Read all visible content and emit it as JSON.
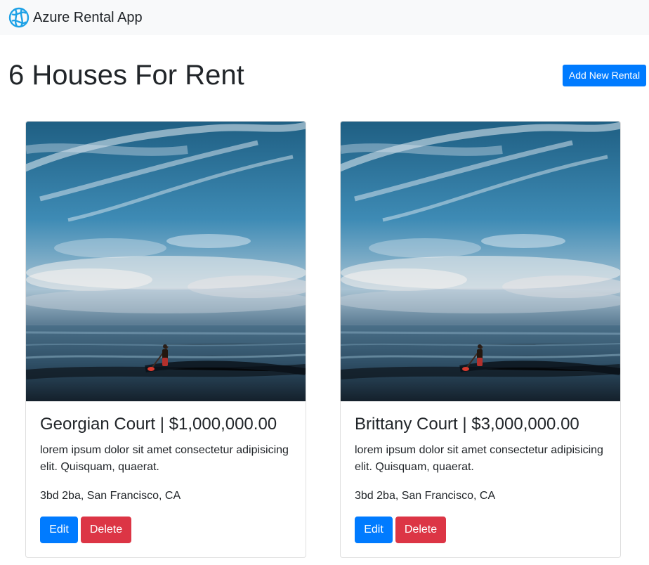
{
  "navbar": {
    "brand_label": "Azure Rental App",
    "brand_icon": "azure-globe-icon",
    "accent_color": "#1da1e6"
  },
  "header": {
    "title": "6 Houses For Rent",
    "add_button_label": "Add New Rental"
  },
  "colors": {
    "primary": "#007bff",
    "danger": "#dc3545",
    "navbar_bg": "#f8f9fa"
  },
  "rentals": [
    {
      "title": "Georgian Court | $1,000,000.00",
      "description": "lorem ipsum dolor sit amet consectetur adipisicing elit. Quisquam, quaerat.",
      "location": "3bd 2ba, San Francisco, CA",
      "image": "ocean-paddleboarder-photo",
      "edit_label": "Edit",
      "delete_label": "Delete"
    },
    {
      "title": "Brittany Court | $3,000,000.00",
      "description": "lorem ipsum dolor sit amet consectetur adipisicing elit. Quisquam, quaerat.",
      "location": "3bd 2ba, San Francisco, CA",
      "image": "ocean-paddleboarder-photo",
      "edit_label": "Edit",
      "delete_label": "Delete"
    }
  ]
}
